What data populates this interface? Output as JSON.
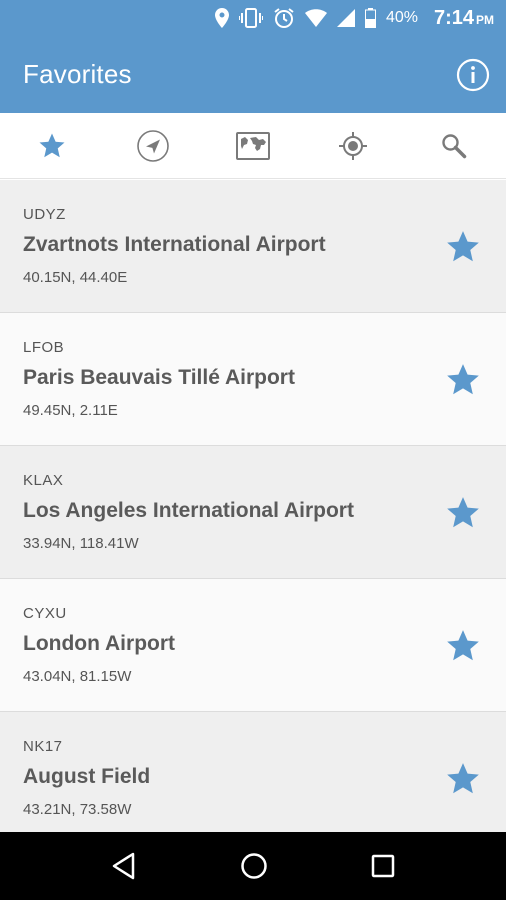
{
  "status_bar": {
    "battery": "40%",
    "time": "7:14",
    "time_suffix": "PM"
  },
  "app_bar": {
    "title": "Favorites"
  },
  "tabs": [
    {
      "icon": "star-icon",
      "active": true
    },
    {
      "icon": "navigation-arrow-icon",
      "active": false
    },
    {
      "icon": "map-icon",
      "active": false
    },
    {
      "icon": "location-target-icon",
      "active": false
    },
    {
      "icon": "search-icon",
      "active": false
    }
  ],
  "airports": [
    {
      "code": "UDYZ",
      "name": "Zvartnots International Airport",
      "coords": "40.15N, 44.40E"
    },
    {
      "code": "LFOB",
      "name": "Paris Beauvais Tillé Airport",
      "coords": "49.45N, 2.11E"
    },
    {
      "code": "KLAX",
      "name": "Los Angeles International Airport",
      "coords": "33.94N, 118.41W"
    },
    {
      "code": "CYXU",
      "name": "London Airport",
      "coords": "43.04N, 81.15W"
    },
    {
      "code": "NK17",
      "name": "August Field",
      "coords": "43.21N, 73.58W"
    }
  ],
  "colors": {
    "accent": "#5b98cc",
    "star": "#5b98cc",
    "inactive_icon": "#7a7a7a"
  }
}
